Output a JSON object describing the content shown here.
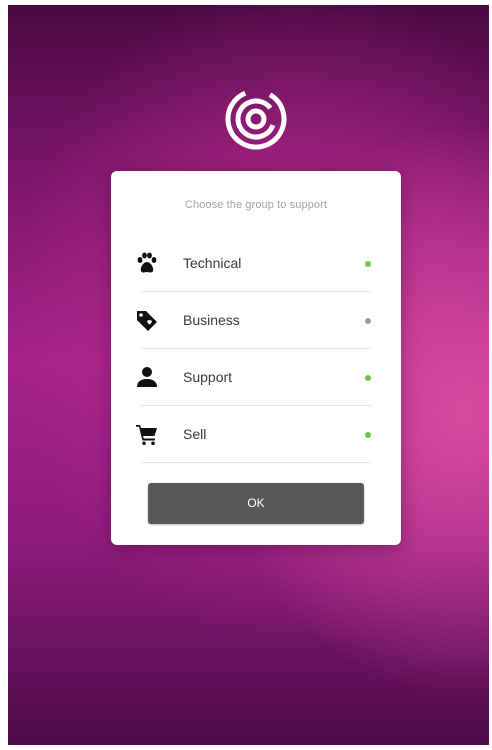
{
  "dialog": {
    "prompt": "Choose the group to support",
    "groups": [
      {
        "label": "Technical",
        "icon": "paw-icon",
        "status_color": "#6cc24a"
      },
      {
        "label": "Business",
        "icon": "tag-icon",
        "status_color": "#9b9b9b"
      },
      {
        "label": "Support",
        "icon": "person-icon",
        "status_color": "#6cc24a"
      },
      {
        "label": "Sell",
        "icon": "cart-icon",
        "status_color": "#6cc24a"
      }
    ],
    "ok_label": "OK"
  },
  "colors": {
    "online": "#6cc24a",
    "offline": "#9b9b9b",
    "button": "#585858",
    "background_accent": "#b62a8c"
  }
}
